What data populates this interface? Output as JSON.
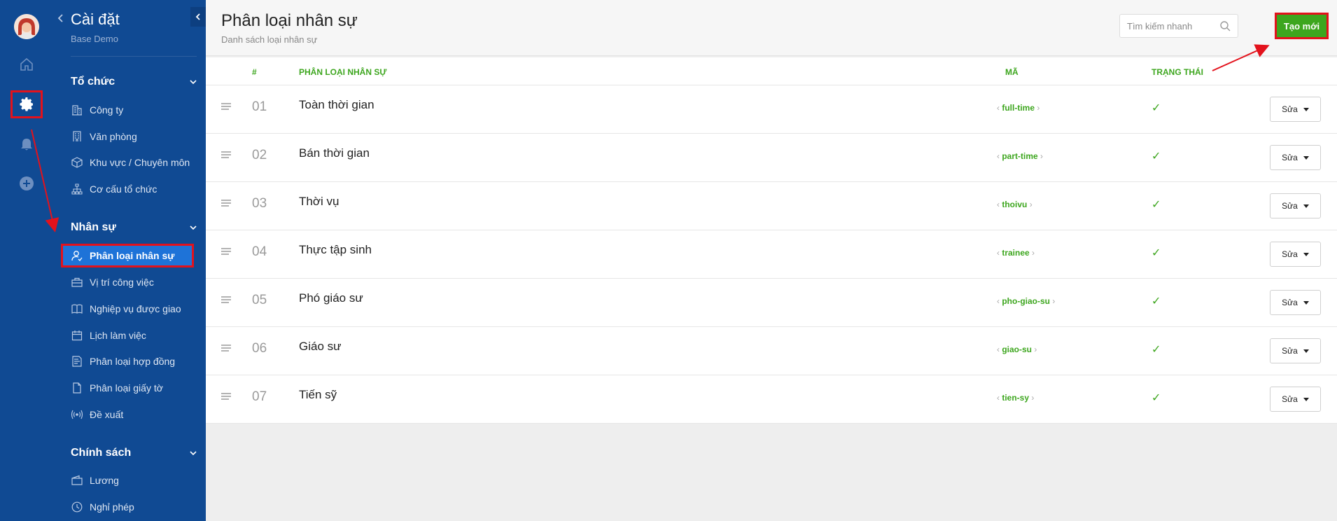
{
  "sidebar": {
    "title": "Cài đặt",
    "subtitle": "Base Demo",
    "sections": [
      {
        "label": "Tổ chức",
        "items": [
          {
            "label": "Công ty",
            "icon": "building-icon"
          },
          {
            "label": "Văn phòng",
            "icon": "office-icon"
          },
          {
            "label": "Khu vực / Chuyên môn",
            "icon": "cube-icon"
          },
          {
            "label": "Cơ cấu tổ chức",
            "icon": "org-chart-icon"
          }
        ]
      },
      {
        "label": "Nhân sự",
        "items": [
          {
            "label": "Phân loại nhân sự",
            "icon": "user-check-icon",
            "active": true
          },
          {
            "label": "Vị trí công việc",
            "icon": "briefcase-icon"
          },
          {
            "label": "Nghiệp vụ được giao",
            "icon": "book-icon"
          },
          {
            "label": "Lịch làm việc",
            "icon": "calendar-icon"
          },
          {
            "label": "Phân loại hợp đồng",
            "icon": "contract-icon"
          },
          {
            "label": "Phân loại giấy tờ",
            "icon": "document-icon"
          },
          {
            "label": "Đề xuất",
            "icon": "broadcast-icon"
          }
        ]
      },
      {
        "label": "Chính sách",
        "items": [
          {
            "label": "Lương",
            "icon": "wallet-icon"
          },
          {
            "label": "Nghỉ phép",
            "icon": "clock-icon"
          }
        ]
      }
    ]
  },
  "header": {
    "title": "Phân loại nhân sự",
    "subtitle": "Danh sách loại nhân sự",
    "search_placeholder": "Tìm kiếm nhanh",
    "create_label": "Tạo mới"
  },
  "table": {
    "columns": {
      "index": "#",
      "name": "PHÂN LOẠI NHÂN SỰ",
      "code": "MÃ",
      "status": "TRẠNG THÁI"
    },
    "edit_label": "Sửa",
    "status_mark": "✓",
    "rows": [
      {
        "num": "01",
        "name": "Toàn thời gian",
        "code": "full-time"
      },
      {
        "num": "02",
        "name": "Bán thời gian",
        "code": "part-time"
      },
      {
        "num": "03",
        "name": "Thời vụ",
        "code": "thoivu"
      },
      {
        "num": "04",
        "name": "Thực tập sinh",
        "code": "trainee"
      },
      {
        "num": "05",
        "name": "Phó giáo sư",
        "code": "pho-giao-su"
      },
      {
        "num": "06",
        "name": "Giáo sư",
        "code": "giao-su"
      },
      {
        "num": "07",
        "name": "Tiến sỹ",
        "code": "tien-sy"
      }
    ]
  },
  "colors": {
    "sidebar_bg": "#104a93",
    "active_bg": "#1e73d8",
    "accent_green": "#3da61e",
    "highlight_red": "#e3121c"
  }
}
